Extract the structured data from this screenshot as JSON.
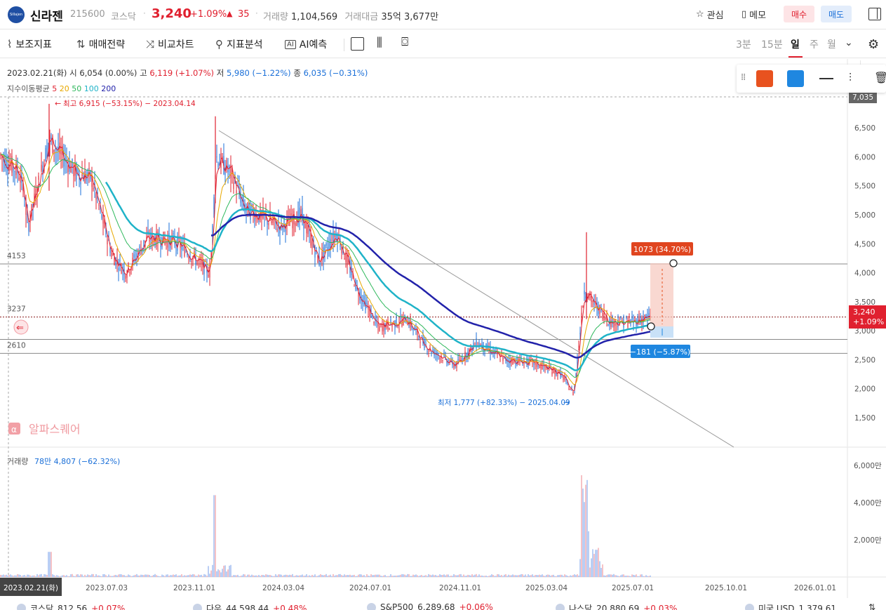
{
  "header": {
    "logo_text": "Sillajen",
    "name": "신라젠",
    "code": "215600",
    "market": "코스닥",
    "price": "3,240",
    "change_pct": "+1.09%",
    "change_abs": "35",
    "volume_label": "거래량",
    "volume": "1,104,569",
    "amount_label": "거래대금",
    "amount": "35억 3,677만",
    "watch_label": "관심",
    "memo_label": "메모",
    "buy_label": "매수",
    "sell_label": "매도"
  },
  "toolbar": {
    "aux_indicator": "보조지표",
    "trade_strategy": "매매전략",
    "compare_chart": "비교차트",
    "indicator_analysis": "지표분석",
    "ai_forecast": "AI예측",
    "timeframes": [
      "3분",
      "15분",
      "일",
      "주",
      "월"
    ],
    "active_timeframe": "일"
  },
  "info": {
    "date": "2023.02.21(화)",
    "open_label": "시",
    "open": "6,054 (0.00%)",
    "high_label": "고",
    "high": "6,119 (+1.07%)",
    "low_label": "저",
    "low": "5,980 (−1.22%)",
    "close_label": "종",
    "close": "6,035 (−0.31%)",
    "ma_label": "지수이동평균",
    "ma_periods": [
      "5",
      "20",
      "50",
      "100",
      "200"
    ],
    "ma_colors": [
      "#e0202f",
      "#e8a800",
      "#2eb85c",
      "#1fb3c8",
      "#2222aa"
    ]
  },
  "drawing_toolbar": {
    "color1": "#e8521f",
    "color2": "#1f87e0"
  },
  "chart": {
    "y_ticks": [
      "7,035",
      "6,500",
      "6,000",
      "5,500",
      "5,000",
      "4,500",
      "4,000",
      "3,500",
      "3,000",
      "2,500",
      "2,000",
      "1,500"
    ],
    "price_tag": "3,240",
    "price_tag_pct": "+1.09%",
    "hlines": [
      "4153",
      "3237",
      "2610"
    ],
    "max_label": "최고 6,915 (−53.15%) − 2023.04.14",
    "min_label": "최저 1,777 (+82.33%) − 2025.04.09",
    "up_box": "1073 (34.70%)",
    "down_box": "−181 (−5.87%)",
    "watermark": "알파스퀘어",
    "volume_label": "거래량",
    "volume_value": "78만 4,807 (−62.32%)",
    "vol_ticks": [
      "6,000만",
      "4,000만",
      "2,000만"
    ],
    "x_ticks": [
      "2023.07.03",
      "2023.11.01",
      "2024.03.04",
      "2024.07.01",
      "2024.11.01",
      "2025.03.04",
      "2025.07.01",
      "2025.10.01",
      "2026.01.01"
    ],
    "cursor_date": "2023.02.21(화)"
  },
  "chart_data": {
    "type": "candlestick",
    "ticker": "215600",
    "x": [
      "2023.02",
      "2023.04",
      "2023.06",
      "2023.08",
      "2023.10",
      "2023.11",
      "2024.01",
      "2024.03",
      "2024.05",
      "2024.07",
      "2024.09",
      "2024.11",
      "2025.01",
      "2025.03",
      "2025.04",
      "2025.05",
      "2025.06",
      "2025.07"
    ],
    "close": [
      6035,
      5800,
      5600,
      4700,
      4100,
      6200,
      5200,
      4850,
      4300,
      3100,
      2750,
      2500,
      2600,
      2300,
      1900,
      4000,
      3200,
      3240
    ],
    "ylim": [
      1300,
      7100
    ],
    "y_ticks": [
      1500,
      2000,
      2500,
      3000,
      3500,
      4000,
      4500,
      5000,
      5500,
      6000,
      6500,
      7035
    ]
  },
  "footer": {
    "items": [
      {
        "name": "코스닥",
        "value": "812.56",
        "chg": "+0.07%"
      },
      {
        "name": "다우",
        "value": "44,598.44",
        "chg": "+0.48%"
      },
      {
        "name": "S&P500",
        "value": "6,289.68",
        "chg": "+0.06%"
      },
      {
        "name": "나스닥",
        "value": "20,880.69",
        "chg": "+0.03%"
      },
      {
        "name": "미국 USD",
        "value": "1,379.61",
        "chg": ""
      }
    ]
  }
}
